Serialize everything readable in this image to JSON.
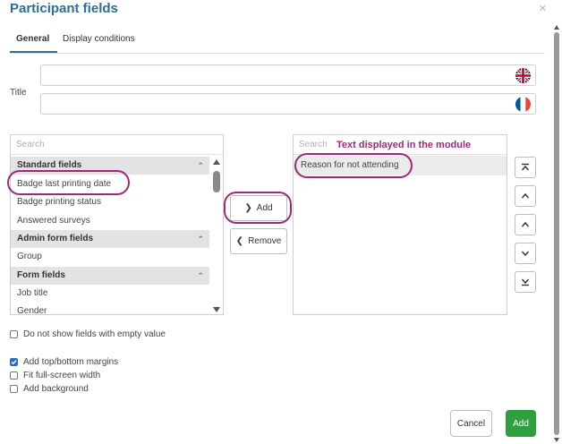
{
  "dialog": {
    "title": "Participant fields",
    "close_icon": "×"
  },
  "tabs": [
    {
      "label": "General",
      "active": true
    },
    {
      "label": "Display conditions",
      "active": false
    }
  ],
  "title_field": {
    "label": "Title",
    "inputs": [
      {
        "lang": "en",
        "value": "",
        "flag_icon": "uk-flag-icon"
      },
      {
        "lang": "fr",
        "value": "",
        "flag_icon": "france-flag-icon"
      }
    ]
  },
  "available": {
    "search_placeholder": "Search",
    "groups": [
      {
        "label": "Standard fields",
        "items": [
          "Badge last printing date",
          "Badge printing status",
          "Answered surveys"
        ]
      },
      {
        "label": "Admin form fields",
        "items": [
          "Group"
        ]
      },
      {
        "label": "Form fields",
        "items": [
          "Job title",
          "Gender"
        ]
      }
    ]
  },
  "transfer": {
    "add_label": "Add",
    "remove_label": "Remove"
  },
  "selected": {
    "search_placeholder": "Search",
    "annotation": "Text displayed in the module",
    "items": [
      "Reason for not attending"
    ]
  },
  "order_buttons": [
    "move-top-icon",
    "move-up-icon",
    "move-up-icon",
    "move-down-icon",
    "move-bottom-icon"
  ],
  "options": {
    "hide_empty": {
      "label": "Do not show fields with empty value",
      "checked": false
    },
    "margins": {
      "label": "Add top/bottom margins",
      "checked": true
    },
    "fit_width": {
      "label": "Fit full-screen width",
      "checked": false
    },
    "background": {
      "label": "Add background",
      "checked": false
    }
  },
  "footer": {
    "cancel_label": "Cancel",
    "add_label": "Add"
  },
  "colors": {
    "title": "#2a6f97",
    "accent_annotation": "#a0287a",
    "primary_button": "#2e9e3e",
    "checkbox": "#2a6fbf"
  }
}
